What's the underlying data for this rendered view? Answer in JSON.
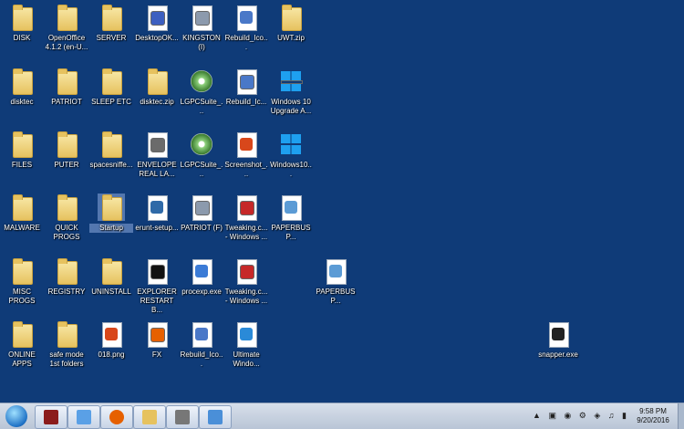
{
  "desktop": {
    "icons": [
      {
        "label": "DISK",
        "type": "folder"
      },
      {
        "label": "OpenOffice 4.1.2 (en-U...",
        "type": "folder"
      },
      {
        "label": "SERVER",
        "type": "folder"
      },
      {
        "label": "DesktopOK...",
        "type": "file"
      },
      {
        "label": "KINGSTON (I)",
        "type": "drive"
      },
      {
        "label": "Rebuild_Ico...",
        "type": "file"
      },
      {
        "label": "UWT.zip",
        "type": "folder"
      },
      {
        "label": "disktec",
        "type": "folder"
      },
      {
        "label": "PATRIOT",
        "type": "folder"
      },
      {
        "label": "SLEEP ETC",
        "type": "folder"
      },
      {
        "label": "disktec.zip",
        "type": "folder"
      },
      {
        "label": "LGPCSuite_...",
        "type": "disc"
      },
      {
        "label": "Rebuild_Ic...",
        "type": "file"
      },
      {
        "label": "Windows 10 Upgrade A...",
        "type": "tile"
      },
      {
        "label": "FILES",
        "type": "folder"
      },
      {
        "label": "PUTER",
        "type": "folder"
      },
      {
        "label": "spacesniffe...",
        "type": "folder"
      },
      {
        "label": "ENVELOPE REAL LA...",
        "type": "file"
      },
      {
        "label": "LGPCSuite_...",
        "type": "disc"
      },
      {
        "label": "Screenshot_...",
        "type": "file"
      },
      {
        "label": "Windows10...",
        "type": "tile"
      },
      {
        "label": "MALWARE",
        "type": "folder"
      },
      {
        "label": "QUICK PROGS",
        "type": "folder"
      },
      {
        "label": "Startup",
        "type": "folder"
      },
      {
        "label": "erunt-setup...",
        "type": "file"
      },
      {
        "label": "PATRIOT (F)",
        "type": "drive"
      },
      {
        "label": "Tweaking.c... - Windows ...",
        "type": "file"
      },
      {
        "label": "PAPERBUSP...",
        "type": "file"
      },
      {
        "label": "MISC PROGS",
        "type": "folder"
      },
      {
        "label": "REGISTRY",
        "type": "folder"
      },
      {
        "label": "UNINSTALL",
        "type": "folder"
      },
      {
        "label": "EXPLORER RESTART B...",
        "type": "file"
      },
      {
        "label": "procexp.exe",
        "type": "file"
      },
      {
        "label": "Tweaking.c... - Windows ...",
        "type": "file"
      },
      {
        "label": "PAPERBUSP...",
        "type": "file"
      },
      {
        "label": "ONLINE APPS",
        "type": "folder"
      },
      {
        "label": "safe mode 1st folders",
        "type": "folder"
      },
      {
        "label": "018.png",
        "type": "file"
      },
      {
        "label": "FX",
        "type": "file"
      },
      {
        "label": "Rebuild_Ico...",
        "type": "file"
      },
      {
        "label": "Ultimate Windo...",
        "type": "file"
      },
      {
        "label": "snapper.exe",
        "type": "file"
      }
    ]
  },
  "taskbar": {
    "clock_time": "9:58 PM",
    "clock_date": "9/20/2016"
  },
  "colors": {
    "desktop": "#0f3b78",
    "selection": "#8caadc"
  }
}
